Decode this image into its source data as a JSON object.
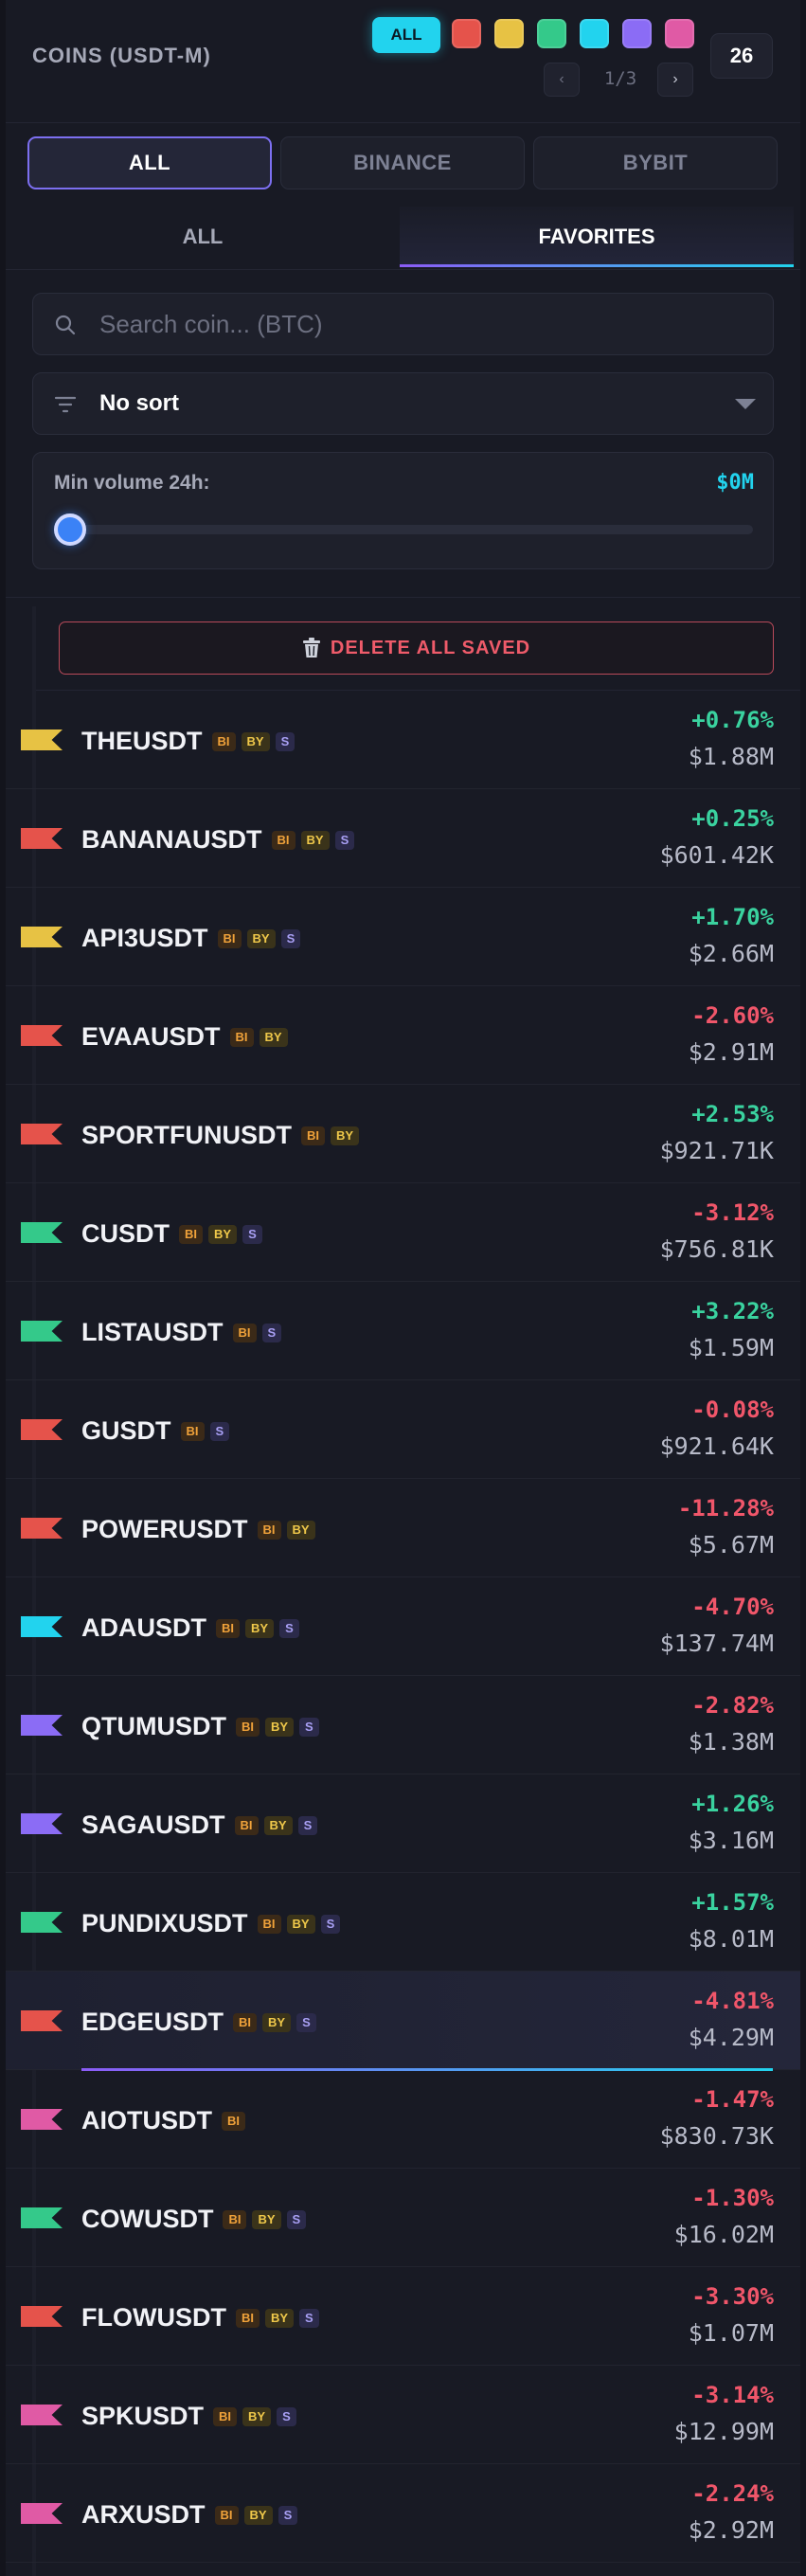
{
  "header": {
    "title": "COINS (USDT-M)",
    "color_filter_all": "ALL",
    "color_filters": [
      "#e5534b",
      "#e7c244",
      "#34c98a",
      "#22d3ee",
      "#8b6cf5",
      "#e05aa5"
    ],
    "page": "1/3",
    "prev_icon": "‹",
    "next_icon": "›",
    "count": "26"
  },
  "exchange_tabs": [
    "ALL",
    "BINANCE",
    "BYBIT"
  ],
  "list_tabs": [
    "ALL",
    "FAVORITES"
  ],
  "search": {
    "placeholder": "Search coin... (BTC)",
    "value": ""
  },
  "sort": {
    "label": "No sort"
  },
  "volume_filter": {
    "label": "Min volume 24h:",
    "value": "$0M",
    "level": 0
  },
  "delete_all": {
    "label": "DELETE ALL SAVED"
  },
  "coins": [
    {
      "symbol": "THEUSDT",
      "flag": "#e7c244",
      "badges": [
        "BI",
        "BY",
        "S"
      ],
      "change": "+0.76%",
      "volume": "$1.88M",
      "dir": "up"
    },
    {
      "symbol": "BANANAUSDT",
      "flag": "#e5534b",
      "badges": [
        "BI",
        "BY",
        "S"
      ],
      "change": "+0.25%",
      "volume": "$601.42K",
      "dir": "up"
    },
    {
      "symbol": "API3USDT",
      "flag": "#e7c244",
      "badges": [
        "BI",
        "BY",
        "S"
      ],
      "change": "+1.70%",
      "volume": "$2.66M",
      "dir": "up"
    },
    {
      "symbol": "EVAAUSDT",
      "flag": "#e5534b",
      "badges": [
        "BI",
        "BY"
      ],
      "change": "-2.60%",
      "volume": "$2.91M",
      "dir": "dn"
    },
    {
      "symbol": "SPORTFUNUSDT",
      "flag": "#e5534b",
      "badges": [
        "BI",
        "BY"
      ],
      "change": "+2.53%",
      "volume": "$921.71K",
      "dir": "up"
    },
    {
      "symbol": "CUSDT",
      "flag": "#34c98a",
      "badges": [
        "BI",
        "BY",
        "S"
      ],
      "change": "-3.12%",
      "volume": "$756.81K",
      "dir": "dn"
    },
    {
      "symbol": "LISTAUSDT",
      "flag": "#34c98a",
      "badges": [
        "BI",
        "S"
      ],
      "change": "+3.22%",
      "volume": "$1.59M",
      "dir": "up"
    },
    {
      "symbol": "GUSDT",
      "flag": "#e5534b",
      "badges": [
        "BI",
        "S"
      ],
      "change": "-0.08%",
      "volume": "$921.64K",
      "dir": "dn"
    },
    {
      "symbol": "POWERUSDT",
      "flag": "#e5534b",
      "badges": [
        "BI",
        "BY"
      ],
      "change": "-11.28%",
      "volume": "$5.67M",
      "dir": "dn"
    },
    {
      "symbol": "ADAUSDT",
      "flag": "#22d3ee",
      "badges": [
        "BI",
        "BY",
        "S"
      ],
      "change": "-4.70%",
      "volume": "$137.74M",
      "dir": "dn"
    },
    {
      "symbol": "QTUMUSDT",
      "flag": "#8b6cf5",
      "badges": [
        "BI",
        "BY",
        "S"
      ],
      "change": "-2.82%",
      "volume": "$1.38M",
      "dir": "dn"
    },
    {
      "symbol": "SAGAUSDT",
      "flag": "#8b6cf5",
      "badges": [
        "BI",
        "BY",
        "S"
      ],
      "change": "+1.26%",
      "volume": "$3.16M",
      "dir": "up"
    },
    {
      "symbol": "PUNDIXUSDT",
      "flag": "#34c98a",
      "badges": [
        "BI",
        "BY",
        "S"
      ],
      "change": "+1.57%",
      "volume": "$8.01M",
      "dir": "up"
    },
    {
      "symbol": "EDGEUSDT",
      "flag": "#e5534b",
      "badges": [
        "BI",
        "BY",
        "S"
      ],
      "change": "-4.81%",
      "volume": "$4.29M",
      "dir": "dn",
      "highlight": true
    },
    {
      "symbol": "AIOTUSDT",
      "flag": "#e05aa5",
      "badges": [
        "BI"
      ],
      "change": "-1.47%",
      "volume": "$830.73K",
      "dir": "dn"
    },
    {
      "symbol": "COWUSDT",
      "flag": "#34c98a",
      "badges": [
        "BI",
        "BY",
        "S"
      ],
      "change": "-1.30%",
      "volume": "$16.02M",
      "dir": "dn"
    },
    {
      "symbol": "FLOWUSDT",
      "flag": "#e5534b",
      "badges": [
        "BI",
        "BY",
        "S"
      ],
      "change": "-3.30%",
      "volume": "$1.07M",
      "dir": "dn"
    },
    {
      "symbol": "SPKUSDT",
      "flag": "#e05aa5",
      "badges": [
        "BI",
        "BY",
        "S"
      ],
      "change": "-3.14%",
      "volume": "$12.99M",
      "dir": "dn"
    },
    {
      "symbol": "ARXUSDT",
      "flag": "#e05aa5",
      "badges": [
        "BI",
        "BY",
        "S"
      ],
      "change": "-2.24%",
      "volume": "$2.92M",
      "dir": "dn"
    }
  ]
}
